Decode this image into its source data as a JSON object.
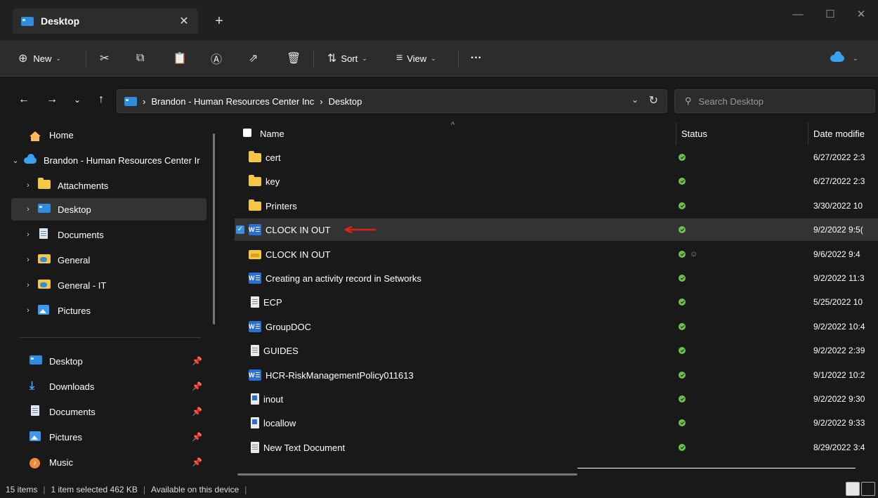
{
  "titlebar": {
    "tab_label": "Desktop",
    "close_glyph": "✕",
    "new_tab_glyph": "+",
    "minimize_glyph": "—",
    "maximize_glyph": "☐",
    "close_window_glyph": "✕"
  },
  "toolbar": {
    "new_label": "New",
    "sort_label": "Sort",
    "view_label": "View",
    "more_glyph": "···"
  },
  "address": {
    "crumbs": [
      "Brandon - Human Resources Center Inc",
      "Desktop"
    ],
    "search_placeholder": "Search Desktop"
  },
  "sidebar": {
    "tree": [
      {
        "label": "Home",
        "icon": "home-icon"
      },
      {
        "label": "Brandon - Human Resources Center Ir",
        "icon": "cloud-icon"
      },
      {
        "label": "Attachments",
        "icon": "folder-icon"
      },
      {
        "label": "Desktop",
        "icon": "desk-icon"
      },
      {
        "label": "Documents",
        "icon": "docs-icon"
      },
      {
        "label": "General",
        "icon": "group-icon"
      },
      {
        "label": "General - IT",
        "icon": "group-icon"
      },
      {
        "label": "Pictures",
        "icon": "pictures-icon"
      }
    ],
    "quick": [
      {
        "label": "Desktop",
        "icon": "desk-icon"
      },
      {
        "label": "Downloads",
        "icon": "download-icon"
      },
      {
        "label": "Documents",
        "icon": "docs-icon"
      },
      {
        "label": "Pictures",
        "icon": "pictures-icon"
      },
      {
        "label": "Music",
        "icon": "music-icon"
      }
    ]
  },
  "list": {
    "columns": {
      "name": "Name",
      "status": "Status",
      "date": "Date modifie"
    },
    "rows": [
      {
        "name": "cert",
        "icon": "folder-icon",
        "date": "6/27/2022 2:3"
      },
      {
        "name": "key",
        "icon": "folder-icon",
        "date": "6/27/2022 2:3"
      },
      {
        "name": "Printers",
        "icon": "folder-icon",
        "date": "3/30/2022 10"
      },
      {
        "name": "CLOCK IN OUT",
        "icon": "word-icon",
        "date": "9/2/2022 9:5("
      },
      {
        "name": "CLOCK IN OUT",
        "icon": "zipfolder-icon",
        "date": "9/6/2022 9:4"
      },
      {
        "name": "Creating an activity record in Setworks",
        "icon": "word-icon",
        "date": "9/2/2022 11:3"
      },
      {
        "name": "ECP",
        "icon": "doc-icon",
        "date": "5/25/2022 10"
      },
      {
        "name": "GroupDOC",
        "icon": "word-icon",
        "date": "9/2/2022 10:4"
      },
      {
        "name": "GUIDES",
        "icon": "doc-icon",
        "date": "9/2/2022 2:39"
      },
      {
        "name": "HCR-RiskManagementPolicy011613",
        "icon": "word-icon",
        "date": "9/1/2022 10:2"
      },
      {
        "name": "inout",
        "icon": "wdoc-icon",
        "date": "9/2/2022 9:30"
      },
      {
        "name": "locallow",
        "icon": "wdoc-icon",
        "date": "9/2/2022 9:33"
      },
      {
        "name": "New Text Document",
        "icon": "doc-icon",
        "date": "8/29/2022 3:4"
      }
    ]
  },
  "status": {
    "items": "15 items",
    "selected": "1 item selected  462 KB",
    "availability": "Available on this device"
  },
  "colors": {
    "accent": "#3b8ee6",
    "ok": "#6cc24a",
    "arrow": "#e0201b"
  }
}
